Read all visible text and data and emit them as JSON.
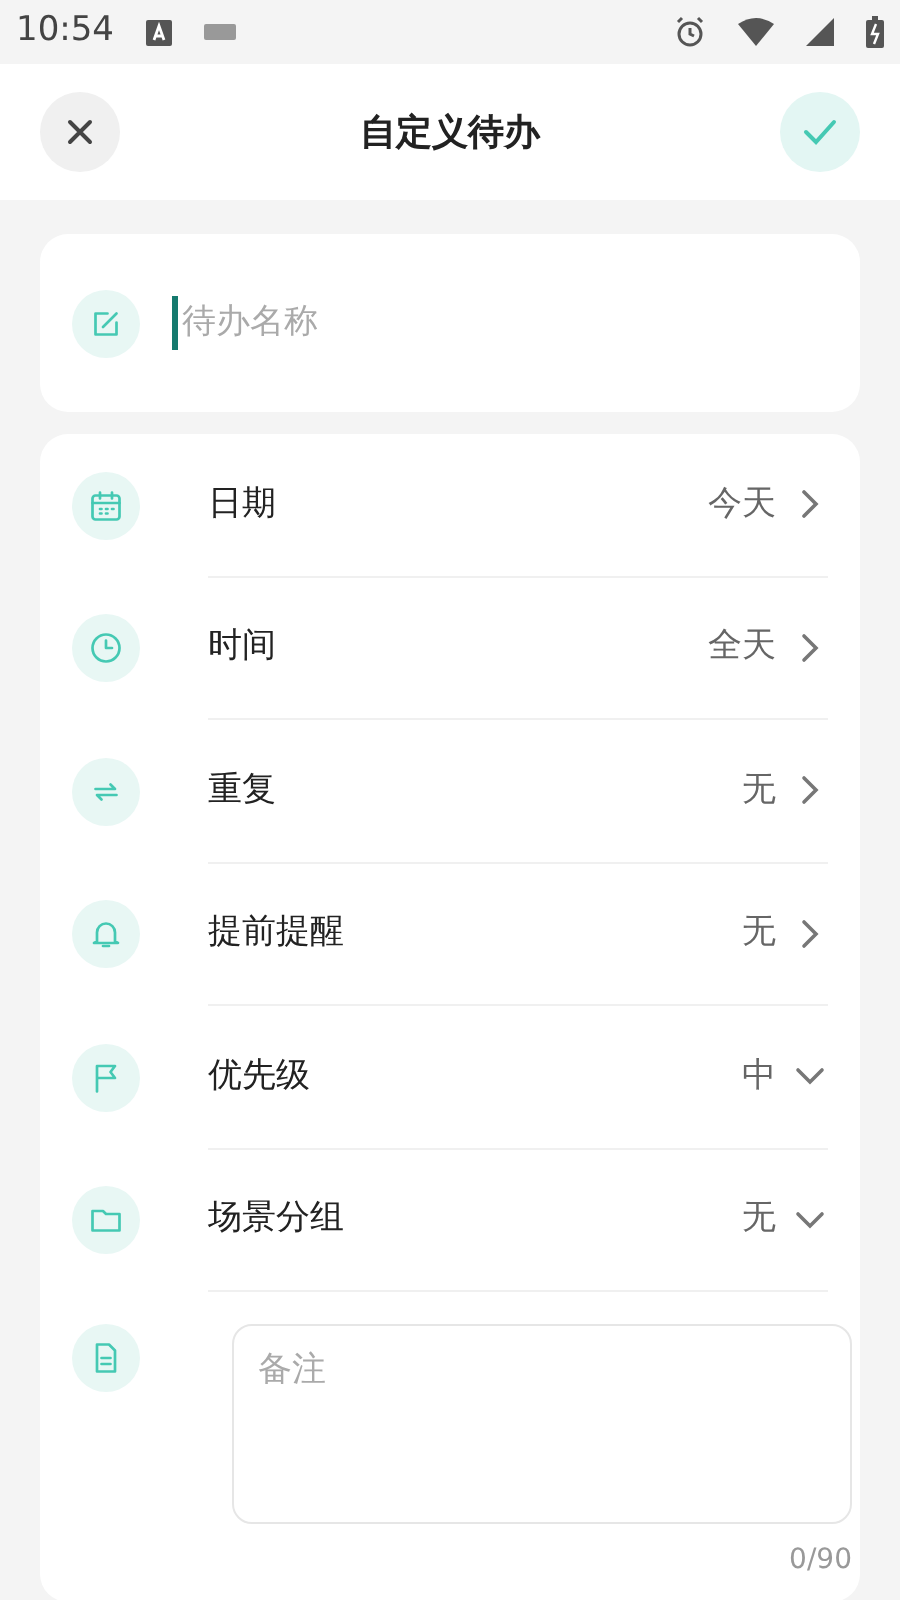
{
  "status_bar": {
    "time": "10:54"
  },
  "header": {
    "title": "自定义待办"
  },
  "name_field": {
    "placeholder": "待办名称",
    "focused": true
  },
  "settings": [
    {
      "label": "日期",
      "value": "今天",
      "kind": "link"
    },
    {
      "label": "时间",
      "value": "全天",
      "kind": "link"
    },
    {
      "label": "重复",
      "value": "无",
      "kind": "link"
    },
    {
      "label": "提前提醒",
      "value": "无",
      "kind": "link"
    },
    {
      "label": "优先级",
      "value": "中",
      "kind": "dropdown"
    },
    {
      "label": "场景分组",
      "value": "无",
      "kind": "dropdown"
    }
  ],
  "note": {
    "placeholder": "备注",
    "counter": "0/90"
  }
}
